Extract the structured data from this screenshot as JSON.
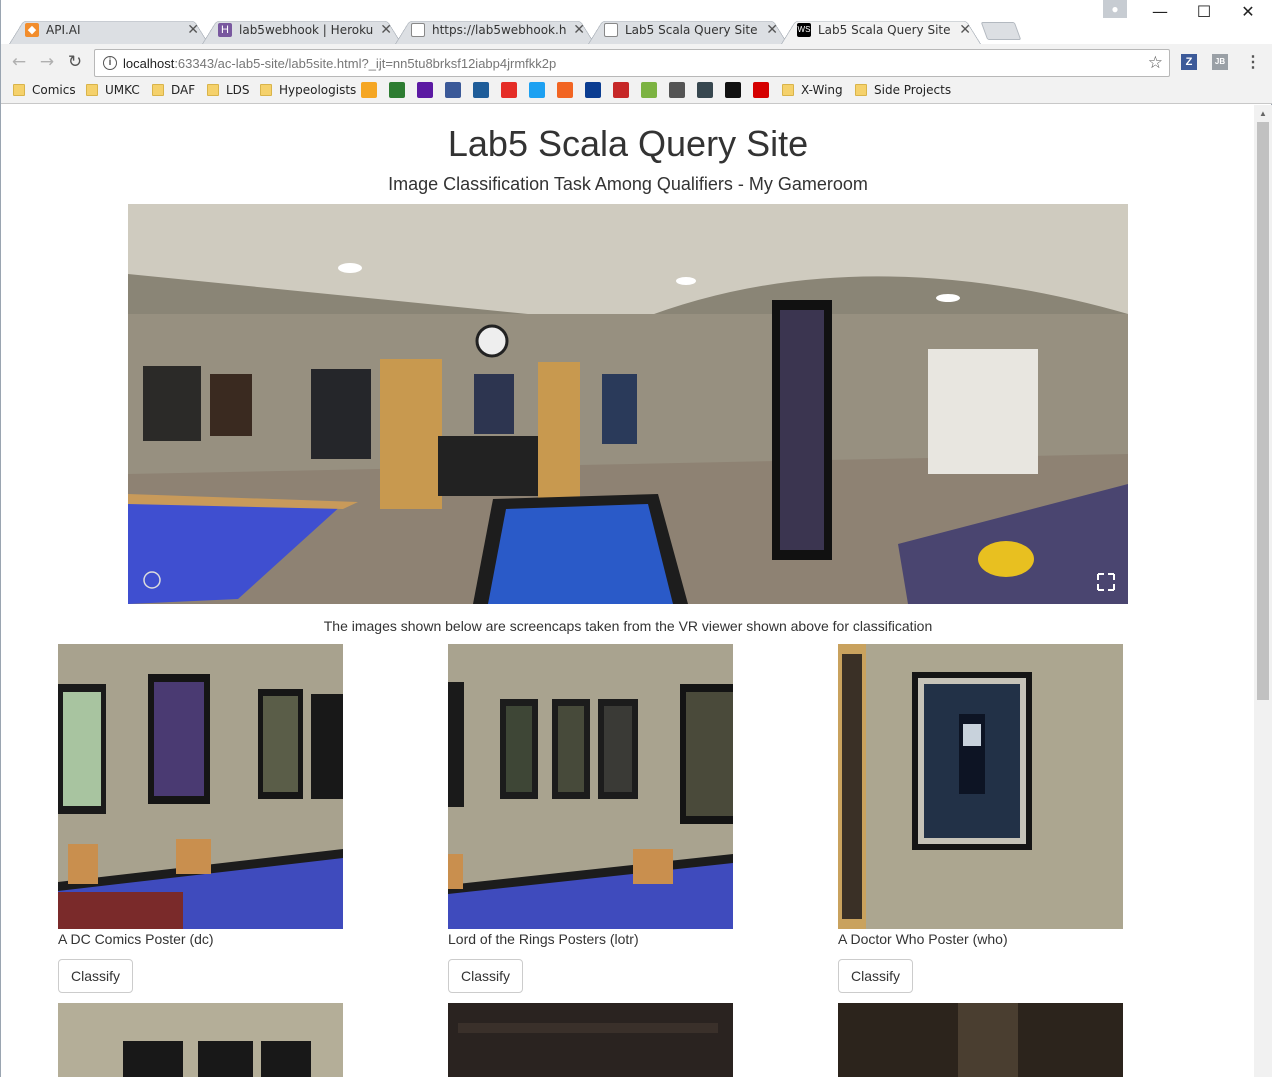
{
  "browser": {
    "tabs": [
      {
        "title": "API.AI",
        "favicon": "api-ai-icon",
        "color": "#f28d2c"
      },
      {
        "title": "lab5webhook | Heroku",
        "favicon": "heroku-icon",
        "color": "#79589f"
      },
      {
        "title": "https://lab5webhook.her",
        "favicon": "page-icon",
        "color": "#888888"
      },
      {
        "title": "Lab5 Scala Query Site",
        "favicon": "page-icon",
        "color": "#888888"
      },
      {
        "title": "Lab5 Scala Query Site",
        "favicon": "webstorm-icon",
        "color": "#000000",
        "active": true
      }
    ],
    "url_host": "localhost",
    "url_path": ":63343/ac-lab5-site/lab5site.html?_ijt=nn5tu8brksf12iabp4jrmfkk2p",
    "bookmarks": [
      "Comics",
      "UMKC",
      "DAF",
      "LDS",
      "Hypeologists",
      "X-Wing",
      "Side Projects"
    ],
    "extension_labels": {
      "z": "Z",
      "jb": "JB"
    }
  },
  "page": {
    "title": "Lab5 Scala Query Site",
    "subtitle": "Image Classification Task Among Qualifiers - My Gameroom",
    "caption": "The images shown below are screencaps taken from the VR viewer shown above for classification",
    "cards": [
      {
        "label": "A DC Comics Poster (dc)",
        "button": "Classify"
      },
      {
        "label": "Lord of the Rings Posters (lotr)",
        "button": "Classify"
      },
      {
        "label": "A Doctor Who Poster (who)",
        "button": "Classify"
      }
    ]
  }
}
